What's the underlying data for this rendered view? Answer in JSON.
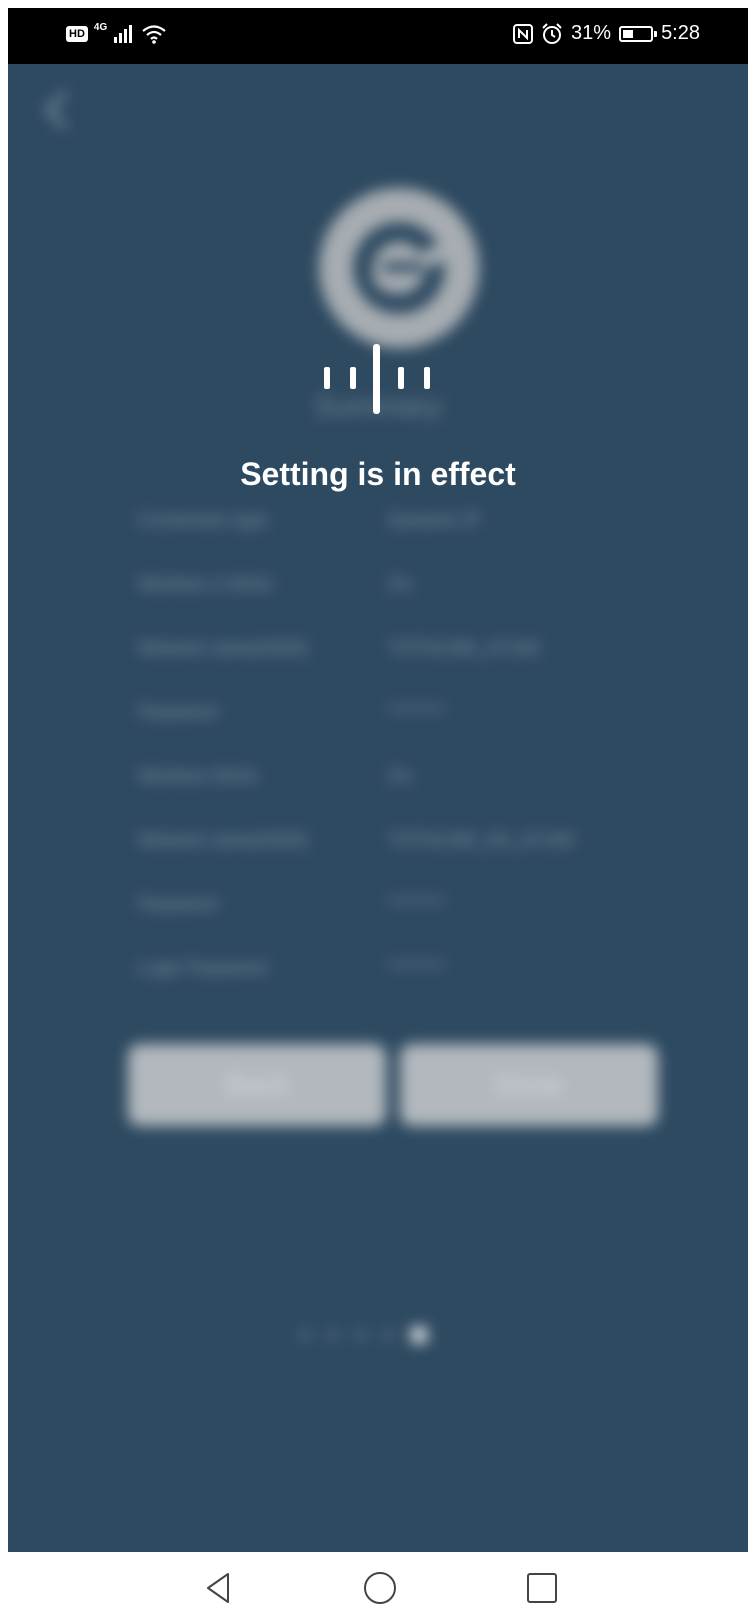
{
  "status_bar": {
    "hd_label": "HD",
    "network_label": "4G",
    "battery_percent": "31%",
    "time": "5:28",
    "icons": [
      "signal-icon",
      "wifi-icon",
      "nfc-icon",
      "alarm-icon",
      "battery-charging-icon"
    ]
  },
  "background": {
    "back_icon": "chevron-left-icon",
    "logo_icon": "app-logo-icon",
    "title": "Summary",
    "rows": [
      {
        "label": "Connection type",
        "value": "Dynamic IP"
      },
      {
        "label": "Wireless 2.4GHz",
        "value": "On"
      },
      {
        "label": "Network name(SSID)",
        "value": "TOTOLINK_A7100"
      },
      {
        "label": "Password",
        "value": "********"
      },
      {
        "label": "Wireless 5GHz",
        "value": "On"
      },
      {
        "label": "Network name(SSID)",
        "value": "TOTOLINK_5G_A7100"
      },
      {
        "label": "Password",
        "value": "********"
      },
      {
        "label": "Login Password",
        "value": "********"
      }
    ],
    "buttons": {
      "back": "Back",
      "done": "Done"
    },
    "pager": {
      "count": 5,
      "active_index": 4
    }
  },
  "overlay": {
    "spinner_icon": "loading-bars-icon",
    "message": "Setting is in effect"
  },
  "nav_bar": {
    "back_icon": "triangle-back-icon",
    "home_icon": "circle-home-icon",
    "recents_icon": "square-recents-icon"
  },
  "colors": {
    "app_background": "#2e4a61",
    "button": "#b2b8be",
    "status_bar": "#000000",
    "overlay_text": "#ffffff"
  }
}
